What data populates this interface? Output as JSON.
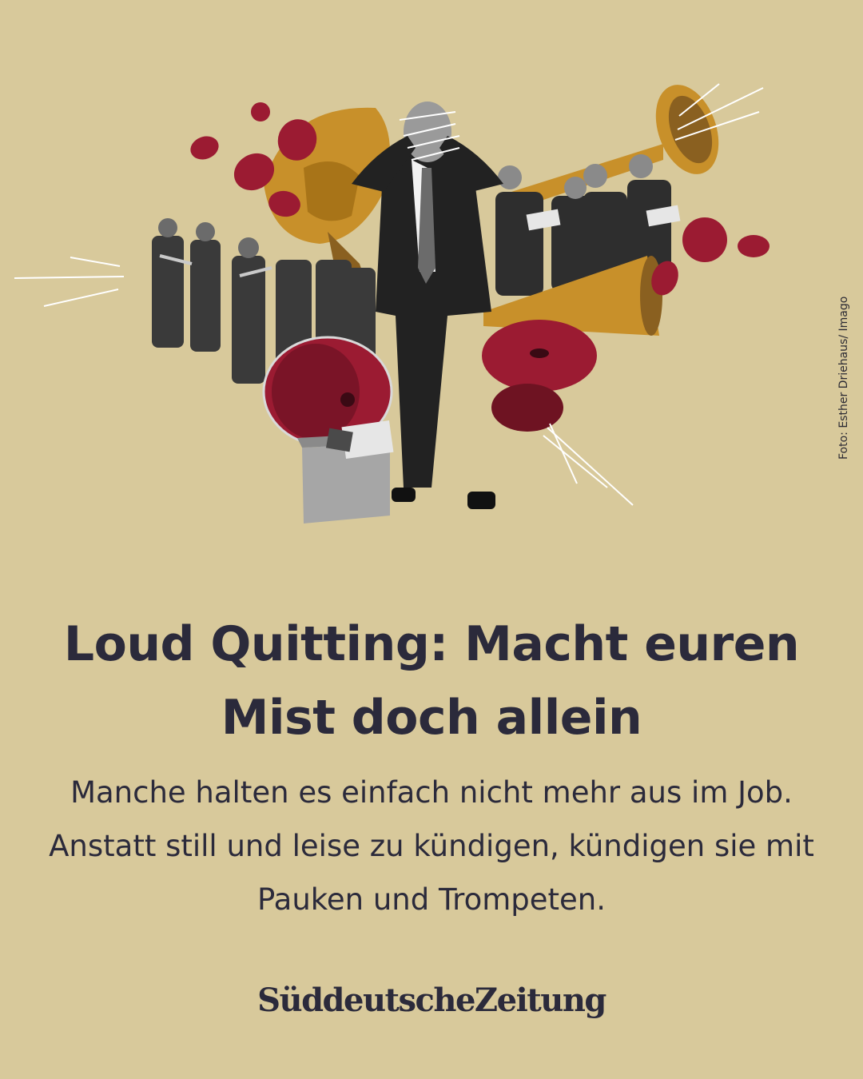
{
  "photo_credit": "Foto: Esther Driehaus/ Imago",
  "headline": "Loud Quitting: Macht euren Mist doch allein",
  "teaser": "Manche halten es einfach nicht mehr aus im Job. Anstatt still und leise zu kündigen, kündigen sie mit Pauken und Trompeten.",
  "publisher_logo": "SüddeutscheZeitung",
  "colors": {
    "background": "#d8c99b",
    "text": "#2b2a3b",
    "brass": "#c8902a",
    "crimson": "#9b1b32"
  },
  "illustration": {
    "elements": [
      "man-covering-face",
      "marching-band",
      "choir-singers",
      "gramophone-horn",
      "trumpet",
      "megaphone",
      "bass-drum",
      "cymbal",
      "moving-box",
      "singing-mouths",
      "sound-lines"
    ]
  }
}
